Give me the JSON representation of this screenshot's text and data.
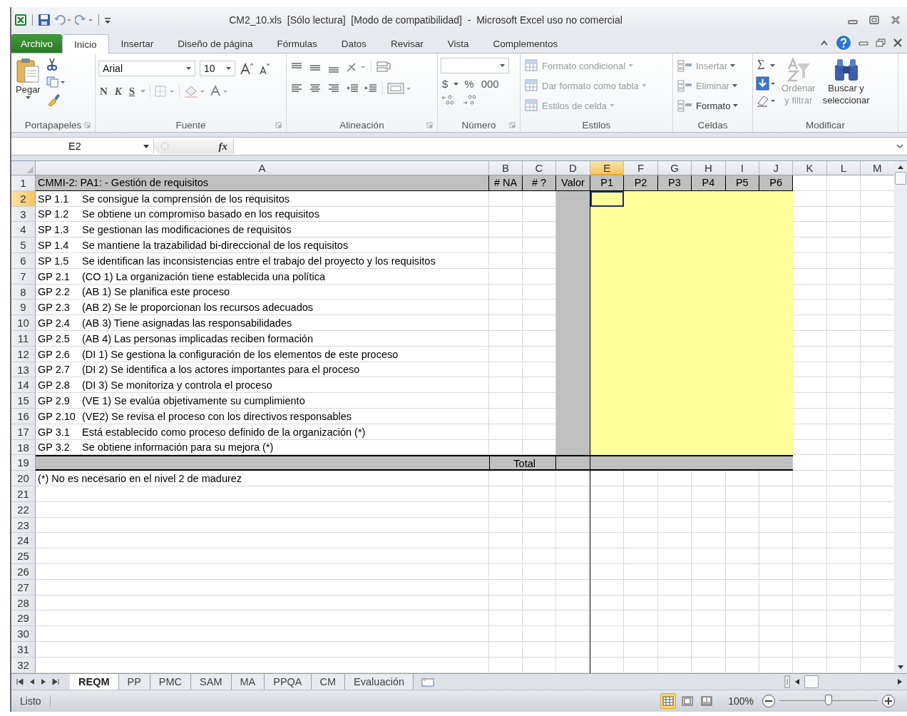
{
  "window": {
    "title": "CM2_10.xls  [Sólo lectura]  [Modo de compatibilidad]  -  Microsoft Excel uso no comercial"
  },
  "ribbon_tabs": [
    {
      "label": "Archivo",
      "kind": "file",
      "selected": false
    },
    {
      "label": "Inicio",
      "kind": "tab",
      "selected": true
    },
    {
      "label": "Insertar",
      "kind": "tab",
      "selected": false
    },
    {
      "label": "Diseño de página",
      "kind": "tab",
      "selected": false
    },
    {
      "label": "Fórmulas",
      "kind": "tab",
      "selected": false
    },
    {
      "label": "Datos",
      "kind": "tab",
      "selected": false
    },
    {
      "label": "Revisar",
      "kind": "tab",
      "selected": false
    },
    {
      "label": "Vista",
      "kind": "tab",
      "selected": false
    },
    {
      "label": "Complementos",
      "kind": "tab",
      "selected": false
    }
  ],
  "ribbon": {
    "groups": [
      {
        "label": "Portapapeles",
        "kind": "clipboard",
        "paste": "Pegar"
      },
      {
        "label": "Fuente",
        "kind": "font",
        "font_name": "Arial",
        "font_size": "10",
        "bold": "N",
        "italic": "K",
        "underline": "S"
      },
      {
        "label": "Alineación",
        "kind": "alignment"
      },
      {
        "label": "Número",
        "kind": "number",
        "currency": "$",
        "percent": "%",
        "thousands": "000"
      },
      {
        "label": "Estilos",
        "kind": "styles",
        "items": [
          {
            "label": "Formato condicional",
            "disabled": true
          },
          {
            "label": "Dar formato como tabla",
            "disabled": true
          },
          {
            "label": "Estilos de celda",
            "disabled": true
          }
        ]
      },
      {
        "label": "Celdas",
        "kind": "cells",
        "items": [
          {
            "label": "Insertar",
            "disabled": true
          },
          {
            "label": "Eliminar",
            "disabled": true
          },
          {
            "label": "Formato",
            "disabled": false
          }
        ]
      },
      {
        "label": "Modificar",
        "kind": "editing",
        "sum": "Σ",
        "sort": {
          "label": "Ordenar\ny filtrar",
          "disabled": true
        },
        "find": {
          "label": "Buscar y\nseleccionar",
          "disabled": false
        }
      }
    ]
  },
  "formula_bar": {
    "name_box": "E2",
    "fx": "fx"
  },
  "columns": [
    {
      "label": "A",
      "selected": false
    },
    {
      "label": "B",
      "selected": false
    },
    {
      "label": "C",
      "selected": false
    },
    {
      "label": "D",
      "selected": false
    },
    {
      "label": "E",
      "selected": true
    },
    {
      "label": "F",
      "selected": false
    },
    {
      "label": "G",
      "selected": false
    },
    {
      "label": "H",
      "selected": false
    },
    {
      "label": "I",
      "selected": false
    },
    {
      "label": "J",
      "selected": false
    },
    {
      "label": "K",
      "selected": false
    },
    {
      "label": "L",
      "selected": false
    },
    {
      "label": "M",
      "selected": false
    }
  ],
  "rows": [
    {
      "number": "1",
      "selected": false,
      "kind": "header",
      "cells": [
        "CMMI-2: PA1: - Gestión de requisitos",
        "# NA",
        "# ?",
        "Valor",
        "P1",
        "P2",
        "P3",
        "P4",
        "P5",
        "P6"
      ]
    },
    {
      "number": "2",
      "selected": true,
      "kind": "item",
      "code": "SP 1.1",
      "text": "Se consigue la comprensión de los requisitos"
    },
    {
      "number": "3",
      "selected": false,
      "kind": "item",
      "code": "SP 1.2",
      "text": "Se obtiene un compromiso basado en los requisitos"
    },
    {
      "number": "4",
      "selected": false,
      "kind": "item",
      "code": "SP 1.3",
      "text": "Se gestionan las modificaciones de requisitos"
    },
    {
      "number": "5",
      "selected": false,
      "kind": "item",
      "code": "SP 1.4",
      "text": "Se mantiene la trazabilidad bi-direccional de los requisitos"
    },
    {
      "number": "6",
      "selected": false,
      "kind": "item",
      "code": "SP 1.5",
      "text": "Se identifican las inconsistencias entre el trabajo del proyecto y los requisitos"
    },
    {
      "number": "7",
      "selected": false,
      "kind": "item",
      "code": "GP 2.1",
      "text": "(CO 1) La organización tiene establecida una política"
    },
    {
      "number": "8",
      "selected": false,
      "kind": "item",
      "code": "GP 2.2",
      "text": "(AB 1) Se planifica este proceso"
    },
    {
      "number": "9",
      "selected": false,
      "kind": "item",
      "code": "GP 2.3",
      "text": "(AB 2) Se le proporcionan los recursos adecuados"
    },
    {
      "number": "10",
      "selected": false,
      "kind": "item",
      "code": "GP 2.4",
      "text": "(AB 3) Tiene asignadas las responsabilidades"
    },
    {
      "number": "11",
      "selected": false,
      "kind": "item",
      "code": "GP 2.5",
      "text": "(AB 4) Las personas implicadas reciben formación"
    },
    {
      "number": "12",
      "selected": false,
      "kind": "item",
      "code": "GP 2.6",
      "text": "(DI 1) Se gestiona la configuración de los elementos de este proceso"
    },
    {
      "number": "13",
      "selected": false,
      "kind": "item",
      "code": "GP 2.7",
      "text": "(DI 2) Se identifica a los actores importantes para el proceso"
    },
    {
      "number": "14",
      "selected": false,
      "kind": "item",
      "code": "GP 2.8",
      "text": "(DI 3) Se monitoriza y controla el proceso"
    },
    {
      "number": "15",
      "selected": false,
      "kind": "item",
      "code": "GP 2.9",
      "text": "(VE 1) Se evalúa objetivamente su cumplimiento"
    },
    {
      "number": "16",
      "selected": false,
      "kind": "item",
      "code": "GP 2.10",
      "text": "(VE2) Se revisa el proceso con los directivos responsables"
    },
    {
      "number": "17",
      "selected": false,
      "kind": "item",
      "code": "GP 3.1",
      "text": "Está establecido como proceso definido de la organización (*)"
    },
    {
      "number": "18",
      "selected": false,
      "kind": "item",
      "code": "GP 3.2",
      "text": "Se obtiene información para su mejora (*)"
    },
    {
      "number": "19",
      "selected": false,
      "kind": "total",
      "label": "Total"
    },
    {
      "number": "20",
      "selected": false,
      "kind": "note",
      "text": "(*) No es necesario en el nivel 2 de madurez"
    },
    {
      "number": "21",
      "selected": false,
      "kind": "empty"
    },
    {
      "number": "22",
      "selected": false,
      "kind": "empty"
    },
    {
      "number": "23",
      "selected": false,
      "kind": "empty"
    },
    {
      "number": "24",
      "selected": false,
      "kind": "empty"
    },
    {
      "number": "25",
      "selected": false,
      "kind": "empty"
    },
    {
      "number": "26",
      "selected": false,
      "kind": "empty"
    },
    {
      "number": "27",
      "selected": false,
      "kind": "empty"
    },
    {
      "number": "28",
      "selected": false,
      "kind": "empty"
    },
    {
      "number": "29",
      "selected": false,
      "kind": "empty"
    },
    {
      "number": "30",
      "selected": false,
      "kind": "empty"
    },
    {
      "number": "31",
      "selected": false,
      "kind": "empty"
    },
    {
      "number": "32",
      "selected": false,
      "kind": "empty"
    }
  ],
  "sheet_tabs": [
    {
      "label": "REQM",
      "selected": true
    },
    {
      "label": "PP",
      "selected": false
    },
    {
      "label": "PMC",
      "selected": false
    },
    {
      "label": "SAM",
      "selected": false
    },
    {
      "label": "MA",
      "selected": false
    },
    {
      "label": "PPQA",
      "selected": false
    },
    {
      "label": "CM",
      "selected": false
    },
    {
      "label": "Evaluación",
      "selected": false
    }
  ],
  "status_bar": {
    "status": "Listo",
    "views": [
      {
        "kind": "normal",
        "selected": true
      },
      {
        "kind": "page_layout",
        "selected": false
      },
      {
        "kind": "page_break",
        "selected": false
      }
    ],
    "zoom": "100%",
    "level": 0.5
  }
}
